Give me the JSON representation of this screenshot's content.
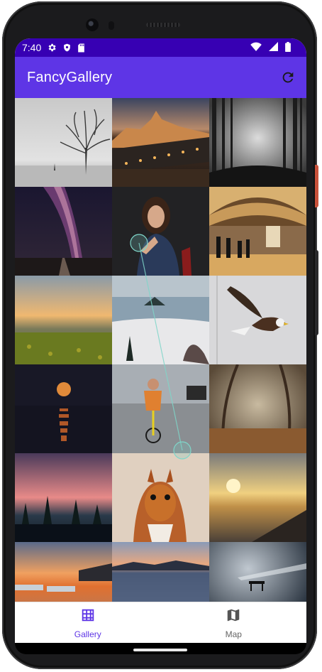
{
  "status_bar": {
    "time": "7:40",
    "left_icons": [
      "settings-icon",
      "shield-icon",
      "sd-card-icon"
    ],
    "right_icons": [
      "wifi-icon",
      "signal-icon",
      "battery-icon"
    ]
  },
  "app_bar": {
    "title": "FancyGallery",
    "action_icon": "refresh-icon"
  },
  "gallery": {
    "photos": [
      "frosted-tree",
      "lit-bridge-city",
      "misty-forest",
      "milky-way-road",
      "woman-portrait",
      "train-station-hall",
      "sunset-field",
      "snowy-lake",
      "bald-eagle",
      "moon-over-water",
      "cyclist-street",
      "autumn-forest",
      "pink-dusk-trees",
      "red-squirrel",
      "sunset-jetty",
      "sunset-salt-flats",
      "mountain-lake",
      "pier-long-exposure"
    ]
  },
  "bottom_nav": {
    "items": [
      {
        "label": "Gallery",
        "icon": "grid-icon",
        "active": true
      },
      {
        "label": "Map",
        "icon": "map-icon",
        "active": false
      }
    ]
  },
  "colors": {
    "status_bar": "#3700b3",
    "app_bar": "#5e35e6",
    "active_nav": "#5e35e6",
    "inactive_nav": "#666666"
  }
}
